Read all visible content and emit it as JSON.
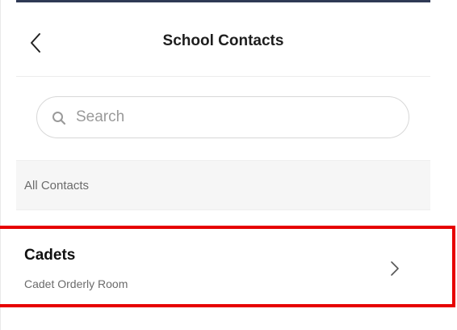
{
  "header": {
    "title": "School Contacts",
    "back_icon": "chevron-left-icon"
  },
  "search": {
    "placeholder": "Search",
    "value": "",
    "icon": "search-icon"
  },
  "sections": [
    {
      "label": "All Contacts",
      "items": [
        {
          "name": "Cadets",
          "subtitle": "Cadet Orderly Room",
          "icon": "chevron-right-icon"
        }
      ]
    }
  ],
  "colors": {
    "top_rule": "#2f3a55",
    "section_bg": "#f6f6f6",
    "highlight": "#e60000"
  }
}
